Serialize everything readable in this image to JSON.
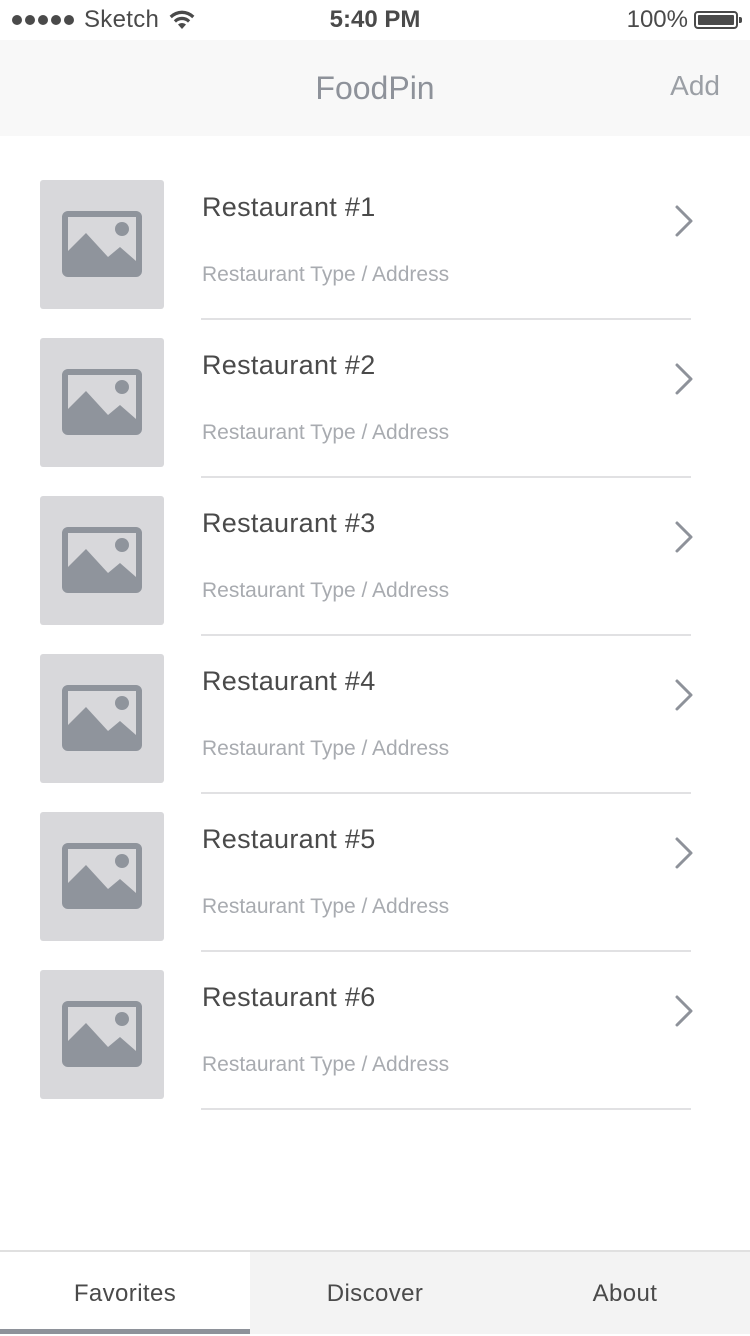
{
  "status_bar": {
    "carrier": "Sketch",
    "time": "5:40 PM",
    "battery": "100%"
  },
  "nav": {
    "title": "FoodPin",
    "add_label": "Add"
  },
  "restaurants": [
    {
      "name": "Restaurant #1",
      "subtitle": "Restaurant Type / Address"
    },
    {
      "name": "Restaurant #2",
      "subtitle": "Restaurant Type / Address"
    },
    {
      "name": "Restaurant #3",
      "subtitle": "Restaurant Type / Address"
    },
    {
      "name": "Restaurant #4",
      "subtitle": "Restaurant Type / Address"
    },
    {
      "name": "Restaurant #5",
      "subtitle": "Restaurant Type / Address"
    },
    {
      "name": "Restaurant #6",
      "subtitle": "Restaurant Type / Address"
    }
  ],
  "tabs": [
    {
      "label": "Favorites",
      "active": true
    },
    {
      "label": "Discover",
      "active": false
    },
    {
      "label": "About",
      "active": false
    }
  ],
  "colors": {
    "nav_background": "#f8f8f8",
    "title_gray": "#8e929a",
    "placeholder_bg": "#d8d8db",
    "placeholder_icon": "#8f949c",
    "tab_indicator": "#8e929a"
  },
  "icons": {
    "row_thumbnail": "image-placeholder-icon",
    "row_accessory": "chevron-right-icon"
  }
}
